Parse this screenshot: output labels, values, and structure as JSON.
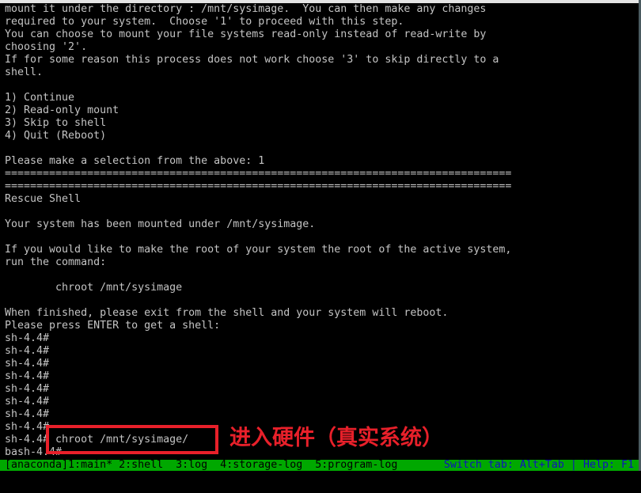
{
  "terminal": {
    "lines": [
      "mount it under the directory : /mnt/sysimage.  You can then make any changes",
      "required to your system.  Choose '1' to proceed with this step.",
      "You can choose to mount your file systems read-only instead of read-write by",
      "choosing '2'.",
      "If for some reason this process does not work choose '3' to skip directly to a",
      "shell.",
      "",
      "1) Continue",
      "2) Read-only mount",
      "3) Skip to shell",
      "4) Quit (Reboot)",
      "",
      "Please make a selection from the above: 1",
      "================================================================================",
      "================================================================================",
      "Rescue Shell",
      "",
      "Your system has been mounted under /mnt/sysimage.",
      "",
      "If you would like to make the root of your system the root of the active system,",
      "run the command:",
      "",
      "        chroot /mnt/sysimage",
      "",
      "When finished, please exit from the shell and your system will reboot.",
      "Please press ENTER to get a shell:",
      "sh-4.4#",
      "sh-4.4#",
      "sh-4.4#",
      "sh-4.4#",
      "sh-4.4#",
      "sh-4.4#",
      "sh-4.4#",
      "sh-4.4#",
      "sh-4.4# chroot /mnt/sysimage/",
      "bash-4.4#"
    ]
  },
  "status_bar": {
    "tabs": "[anaconda]1:main* 2:shell  3:log  4:storage-log  5:program-log",
    "help": "Switch tab: Alt+Tab | Help: F1"
  },
  "annotation": {
    "text": "进入硬件（真实系统）",
    "color": "#e8202a"
  },
  "colors": {
    "terminal_bg": "#000000",
    "terminal_fg": "#c4c4c4",
    "status_bg": "#00a800",
    "status_help_fg": "#1010c0"
  }
}
